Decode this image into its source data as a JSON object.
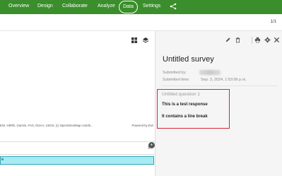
{
  "nav": {
    "items": [
      "Overview",
      "Design",
      "Collaborate",
      "Analyze",
      "Data",
      "Settings"
    ],
    "active": "Data",
    "share_icon": "share-icon"
  },
  "pagination": {
    "label": "1/1"
  },
  "map": {
    "attribution": "Esri, HERE, Garmin, FAO, NOAA, USGS, (c) OpenStreetMap contrib...",
    "powered_by": "Powered by Esri",
    "tools": [
      "grid-icon",
      "layers-icon"
    ]
  },
  "table": {
    "selected_row_label": "e"
  },
  "panel": {
    "toolbar_icons": [
      "edit-icon",
      "delete-icon",
      "print-icon",
      "settings-icon",
      "close-icon"
    ],
    "title": "Untitled survey",
    "submitted_by_label": "Submitted by:",
    "submitted_time_label": "Submitted time:",
    "submitted_time_value": "Sep. 3, 2024, 1:53:06 p.m.",
    "question_label": "Untitled question 1",
    "answer_lines": [
      "This is a test response",
      "It contains a line break"
    ]
  },
  "colors": {
    "nav_bg": "#3a8e2b",
    "highlight_border": "#d9272e",
    "selected_row": "#a8ecf3"
  }
}
